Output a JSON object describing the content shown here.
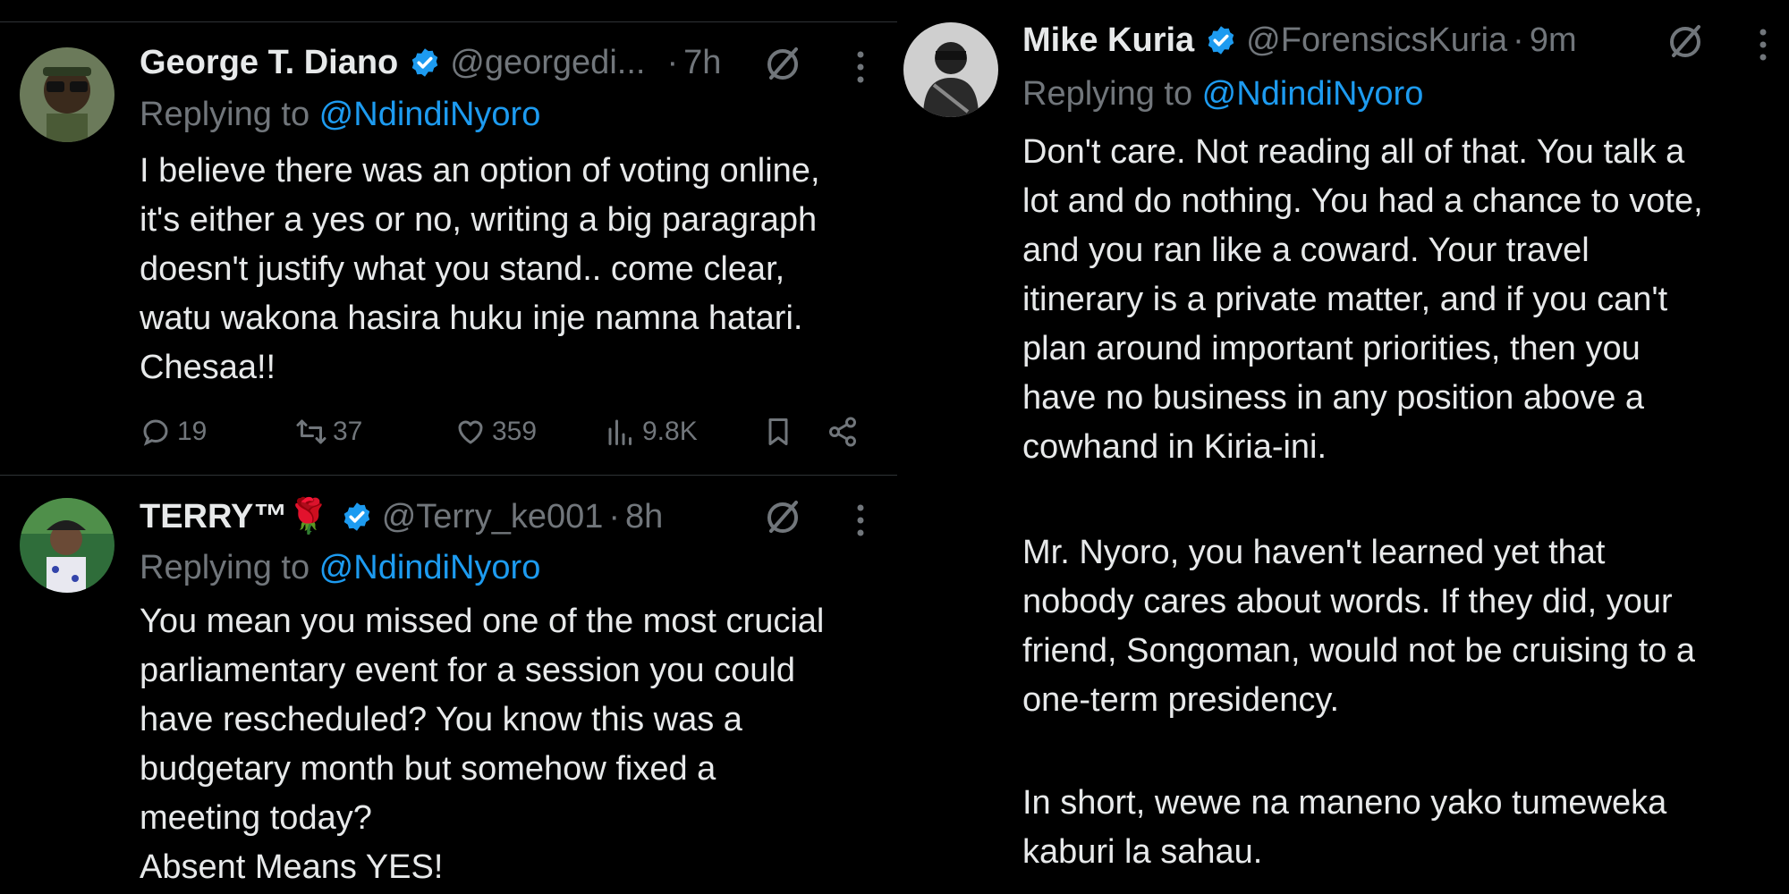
{
  "tweets_left": [
    {
      "name": "George T. Diano",
      "handle": "@georgedi...",
      "time_sep": "·",
      "time": "7h",
      "replying_prefix": "Replying to ",
      "replying_handle": "@NdindiNyoro",
      "lines": [
        "I believe there was an option of voting online,",
        "it's either a yes or no, writing a big paragraph",
        "doesn't justify what you stand.. come clear,",
        "watu wakona hasira huku inje namna hatari.",
        "Chesaa!!"
      ],
      "stats": {
        "replies": "19",
        "reposts": "37",
        "likes": "359",
        "views": "9.8K"
      }
    },
    {
      "name": "TERRY™🌹",
      "handle": "@Terry_ke001",
      "time_sep": "·",
      "time": "8h",
      "replying_prefix": "Replying to ",
      "replying_handle": "@NdindiNyoro",
      "lines": [
        "You mean you missed one of the most crucial",
        "parliamentary event for a session you could",
        "have rescheduled?  You know this was a",
        "budgetary month but somehow fixed a",
        "meeting today?",
        "Absent Means YES!"
      ]
    }
  ],
  "tweet_right": {
    "name": "Mike Kuria",
    "handle": "@ForensicsKuria",
    "time_sep": "·",
    "time": "9m",
    "replying_prefix": "Replying to ",
    "replying_handle": "@NdindiNyoro",
    "paragraph1": [
      "Don't care. Not reading all of that. You talk a",
      "lot and do nothing. You had a chance to vote,",
      "and you ran like a coward. Your travel",
      "itinerary is a private matter, and if you can't",
      "plan around important priorities, then you",
      "have no business in any position above a",
      "cowhand in Kiria-ini."
    ],
    "paragraph2": [
      "Mr. Nyoro, you haven't learned yet that",
      "nobody cares about words. If they did, your",
      "friend, Songoman, would not be cruising to a",
      "one-term presidency."
    ],
    "paragraph3": [
      "In short, wewe na maneno yako tumeweka",
      "kaburi la sahau."
    ]
  },
  "colors": {
    "background": "#000000",
    "text": "#e7e9ea",
    "muted": "#71767b",
    "link": "#1d9bf0",
    "divider": "#2f3336"
  },
  "icons": [
    "verified-badge-icon",
    "grok-icon",
    "more-icon",
    "reply-icon",
    "repost-icon",
    "like-icon",
    "views-icon",
    "bookmark-icon",
    "share-icon"
  ]
}
